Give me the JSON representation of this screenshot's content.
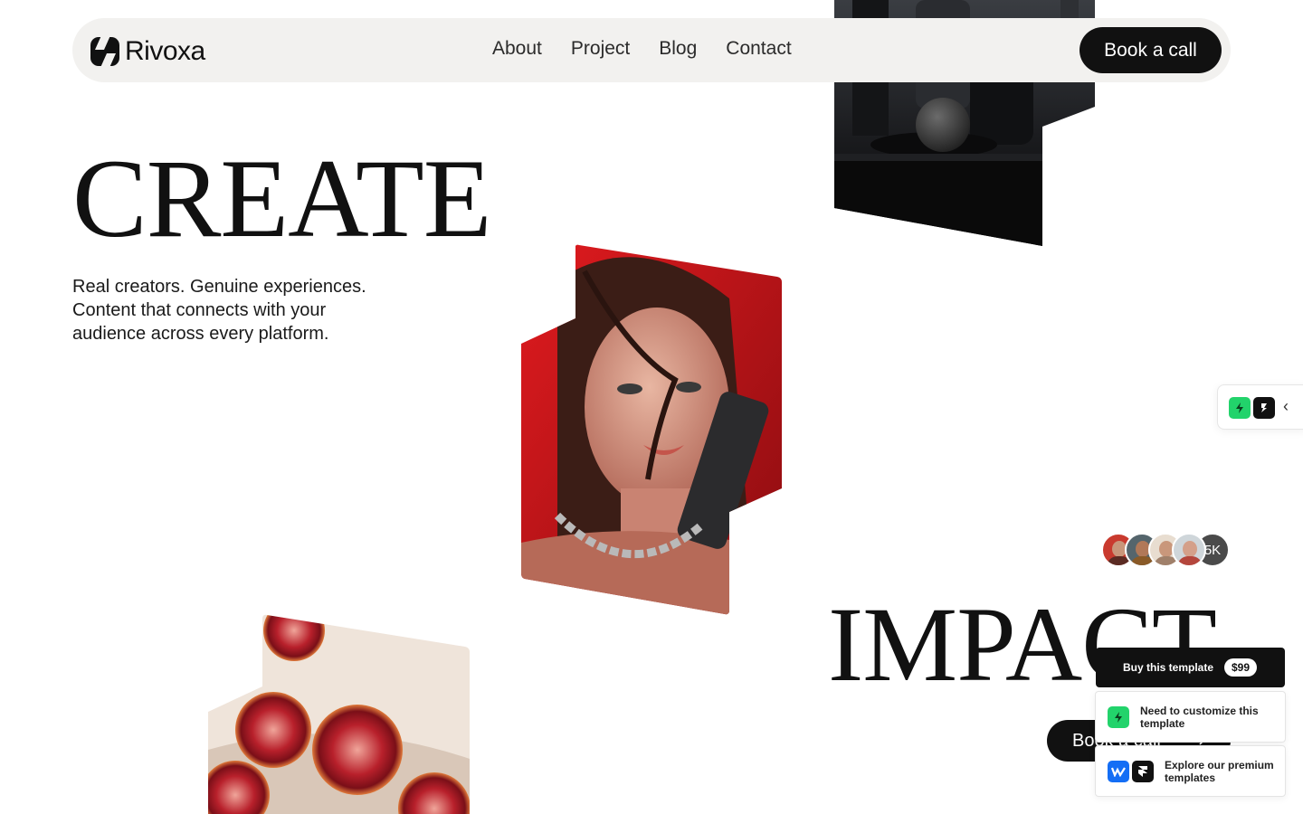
{
  "nav": {
    "brand": "Rivoxa",
    "links": [
      "About",
      "Project",
      "Blog",
      "Contact"
    ],
    "cta": "Book a call"
  },
  "hero": {
    "headline_top": "CREATE",
    "subtext": "Real creators. Genuine experiences. Content that connects with your audience across every platform.",
    "headline_bottom": "IMPACT",
    "avatar_count": "5K",
    "cta": "Book a call"
  },
  "promo": {
    "buy_label": "Buy this template",
    "price": "$99",
    "customize_label": "Need to customize this template",
    "explore_label": "Explore our premium templates"
  },
  "icons": {
    "logo": "rivoxa-logo-icon",
    "toggle_chevron": "chevron-left-icon",
    "cta_arrow": "arrow-up-right-icon"
  },
  "colors": {
    "navbar_bg": "#f2f1ef",
    "primary": "#111111",
    "accent_green": "#22d36b",
    "accent_blue": "#146ef5",
    "hero_red": "#c8161b"
  }
}
